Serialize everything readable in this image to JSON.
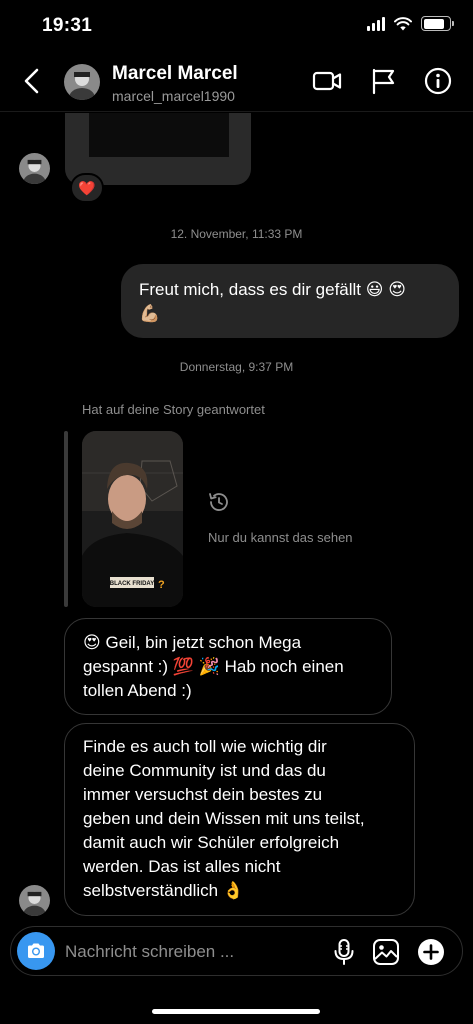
{
  "status_bar": {
    "time": "19:31",
    "battery_level": 0.8
  },
  "header": {
    "name": "Marcel Marcel",
    "username": "marcel_marcel1990"
  },
  "thread": {
    "reaction_emoji": "❤️",
    "ts_1": "12. November, 11:33 PM",
    "out_1": {
      "text": "Freut mich, dass es dir gefällt",
      "emoji_1": "😃",
      "emoji_2": "😍",
      "emoji_3": "💪🏼"
    },
    "ts_2": "Donnerstag, 9:37 PM",
    "story_reply": {
      "caption": "Hat auf deine Story geantwortet",
      "hidden_text": "Nur du kannst das sehen",
      "shirt_text": "BLACK FRIDAY"
    },
    "in_1": {
      "emoji_1": "😍",
      "line_1": "Geil, bin jetzt schon Mega",
      "line_2a": "gespannt :)",
      "emoji_2": "💯",
      "emoji_3": "🎉",
      "line_2b": "Hab noch einen",
      "line_3": "tollen Abend :)"
    },
    "in_2": {
      "lines": [
        "Finde es auch toll wie wichtig dir",
        "deine Community ist und das du",
        "immer versuchst dein bestes zu",
        "geben und dein Wissen mit uns teilst,",
        "damit auch wir Schüler erfolgreich",
        "werden. Das ist alles nicht"
      ],
      "last_line": "selbstverständlich",
      "emoji": "👌"
    }
  },
  "composer": {
    "placeholder": "Nachricht schreiben ..."
  },
  "colors": {
    "background": "#000000",
    "bubble_outgoing": "#262626",
    "bubble_incoming_border": "#363636",
    "accent": "#3897f0"
  }
}
